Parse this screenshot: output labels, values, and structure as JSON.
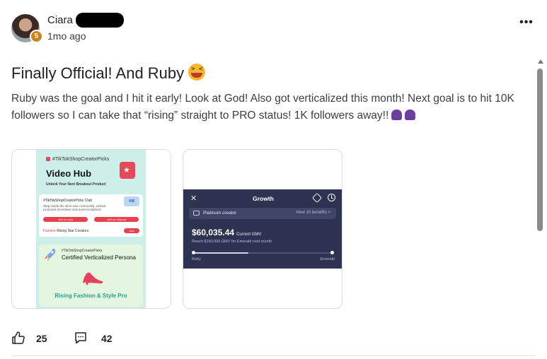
{
  "author": {
    "name": "Ciara",
    "level": "5",
    "time": "1mo ago"
  },
  "post": {
    "title": "Finally Official! And Ruby",
    "title_emoji": "laughing-face-emoji",
    "body": "Ruby was the goal and I hit it early! Look at God! Also got verticalized this month! Next goal is to hit 10K followers so I can take that “rising” straight to PRO status! 1K followers away!!",
    "body_emoji": "praying-hands-emoji"
  },
  "attachment1": {
    "tag": "#TikTokShopCreatorPicks",
    "hub_title": "Video Hub",
    "hub_sub": "Unlock Your Next Breakout Product",
    "club": "#TikTokShopCreatorPicks Club",
    "club_sub": "Step inside the all-in-one community. Unlock exclusive incentives and event invitations",
    "vib": "VIB",
    "btn_join": "Join on com",
    "btn_discord": "Join on Discord",
    "rising_prefix": "Fashion",
    "rising_label": "Rising Star Creators",
    "rising_btn": "Join",
    "persona_tag": "#TikTokShopCreatorPicks",
    "persona_title": "Certified Verticalized Persona",
    "persona_footer": "Rising Fashion & Style Pro"
  },
  "attachment2": {
    "title": "Growth",
    "tier": "Platinum creator",
    "benefits_link": "View 10 benefits >",
    "gmv": "$60,035.44",
    "gmv_label": "Current GMV",
    "reach": "Reach $150,000 GMV for Emerald next month",
    "progress": 0.4,
    "start_label": "Ruby",
    "end_label": "Emerald"
  },
  "actions": {
    "likes": "25",
    "comments": "42"
  },
  "colors": {
    "accent_red": "#e5414f",
    "growth_bg": "#2d3350",
    "badge": "#c9831a"
  }
}
